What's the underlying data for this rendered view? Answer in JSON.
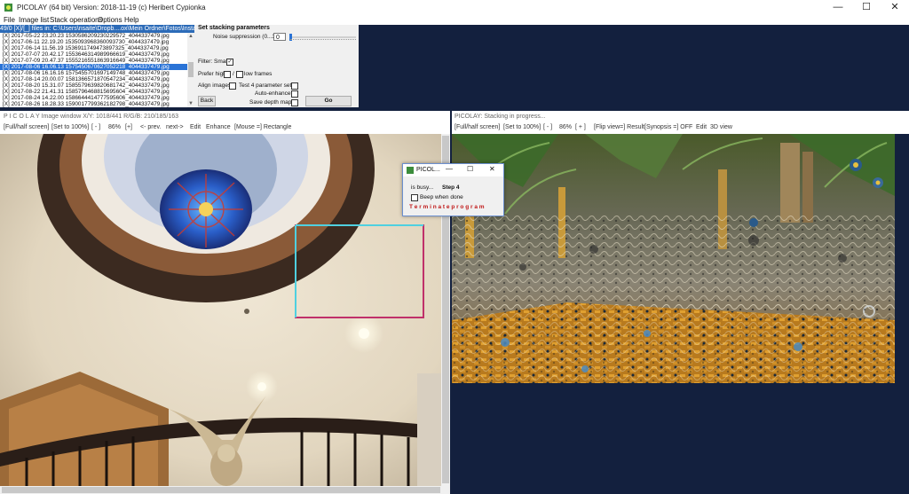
{
  "window": {
    "title": "PICOLAY  (64 bit)  Version: 2018-11-19  (c) Heribert Cypionka",
    "min_label": "—",
    "max_label": "☐",
    "close_label": "✕"
  },
  "menu": [
    "File",
    "Image list",
    "Stack operations",
    "Options",
    "Help"
  ],
  "file_list": {
    "header": "49/0 [X]/[_] files in: C:\\Users\\nsaite\\Dropb....ox\\Mein Ordner\\Fotos\\Instagram",
    "items": [
      "[X] 2017-05-22 23.20.23 1530586209230229572_4044337479.jpg",
      "[X] 2017-06-11 22.19.20 1535093968360093730_4044337479.jpg",
      "[X] 2017-06-14 11.56.19 1536911749473897325_4044337479.jpg",
      "[X] 2017-07-07 20.42.17 1553646314989966619_4044337479.jpg",
      "[X] 2017-07-09 20.47.37 1555216551863916649_4044337479.jpg",
      "[X] 2017-08-06 16.06.13 1575450670627052218_4044337479.jpg",
      "[X] 2017-08-06 16.16.16 1575455701697149748_4044337479.jpg",
      "[X] 2017-08-14 20.00.07 1581366571870547234_4044337479.jpg",
      "[X] 2017-08-20 15.31.07 1585579639820681742_4044337479.jpg",
      "[X] 2017-08-22 21.41.31 1585796468815695604_4044337479.jpg",
      "[X] 2017-08-24 14.22.00 1586644414777595606_4044337479.jpg",
      "[X] 2017-08-26 18.28.33 1590017799362182798_4044337479.jpg"
    ],
    "selected_index": 5
  },
  "params": {
    "heading": "Set stacking parameters",
    "noise_label": "Noise suppression (0...30)",
    "noise_value": "0",
    "filter_label": "Filter: Smart",
    "filter_checked": "✓",
    "prefer_label": "Prefer high",
    "prefer_slash": "/",
    "low_frames_label": "low frames",
    "align_label": "Align images",
    "test4_label": "Test 4 parameter sets",
    "auto_enhance_label": "Auto-enhance",
    "save_depth_label": "Save depth map",
    "back_label": "Back",
    "go_label": "Go"
  },
  "image_window": {
    "title": "P I C O L A Y  Image window X/Y: 1018/441 R/G/B: 210/185/163",
    "toolbar": [
      "[Full/half screen]",
      "[Set to 100%]",
      "[ - ]",
      "86%",
      "[+]",
      "<- prev.",
      "next->",
      "Edit",
      "Enhance",
      "[Mouse =] Rectangle"
    ]
  },
  "stack_window": {
    "title": "PICOLAY: Stacking in progress...",
    "toolbar": [
      "[Full/half screen]",
      "[Set to 100%]",
      "[ - ]",
      "86%",
      "[ + ]",
      "[Flip view=] Result",
      "[Synopsis =] OFF",
      "Edit",
      "3D view"
    ]
  },
  "popup": {
    "title": "PICOL...",
    "status_label": "is busy...",
    "step_label": "Step 4",
    "beep_label": "Beep when done",
    "terminate_label": "T e r m i n a t e   p r o g r a m",
    "min_label": "—",
    "max_label": "☐",
    "close_label": "✕"
  },
  "colors": {
    "accent": "#2c6bb8",
    "selection": "#2a73d6",
    "background": "#13203e",
    "terminate": "#c01818",
    "rect_cyan": "#4fd0e0",
    "rect_red": "#c0306a"
  },
  "icons": [
    "app-icon",
    "minimize-icon",
    "maximize-icon",
    "close-icon",
    "checkbox-icon",
    "scroll-arrow-icon"
  ]
}
